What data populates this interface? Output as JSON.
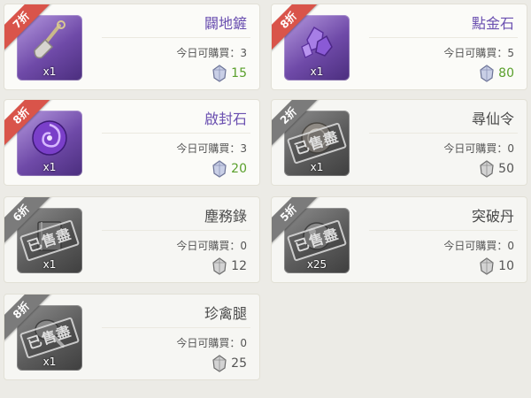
{
  "limit_label": "今日可購買：",
  "items": [
    {
      "name": "闢地鏟",
      "discount": "7折",
      "qty": "x1",
      "limit": "3",
      "price": "15",
      "sold_out": false
    },
    {
      "name": "點金石",
      "discount": "8折",
      "qty": "x1",
      "limit": "5",
      "price": "80",
      "sold_out": false
    },
    {
      "name": "啟封石",
      "discount": "8折",
      "qty": "x1",
      "limit": "3",
      "price": "20",
      "sold_out": false
    },
    {
      "name": "尋仙令",
      "discount": "2折",
      "qty": "x1",
      "limit": "0",
      "price": "50",
      "sold_out": true
    },
    {
      "name": "塵務錄",
      "discount": "6折",
      "qty": "x1",
      "limit": "0",
      "price": "12",
      "sold_out": true
    },
    {
      "name": "突破丹",
      "discount": "5折",
      "qty": "x25",
      "limit": "0",
      "price": "10",
      "sold_out": true
    },
    {
      "name": "珍禽腿",
      "discount": "8折",
      "qty": "x1",
      "limit": "0",
      "price": "25",
      "sold_out": true
    }
  ],
  "sold_out_label": "已售盡",
  "colors": {
    "accent": "#6a4fb0",
    "price_green": "#5aa02c",
    "ribbon_red": "#d9544a",
    "ribbon_gray": "#7b7b7b"
  },
  "icons": {
    "currency": "silver-crystal-icon"
  }
}
